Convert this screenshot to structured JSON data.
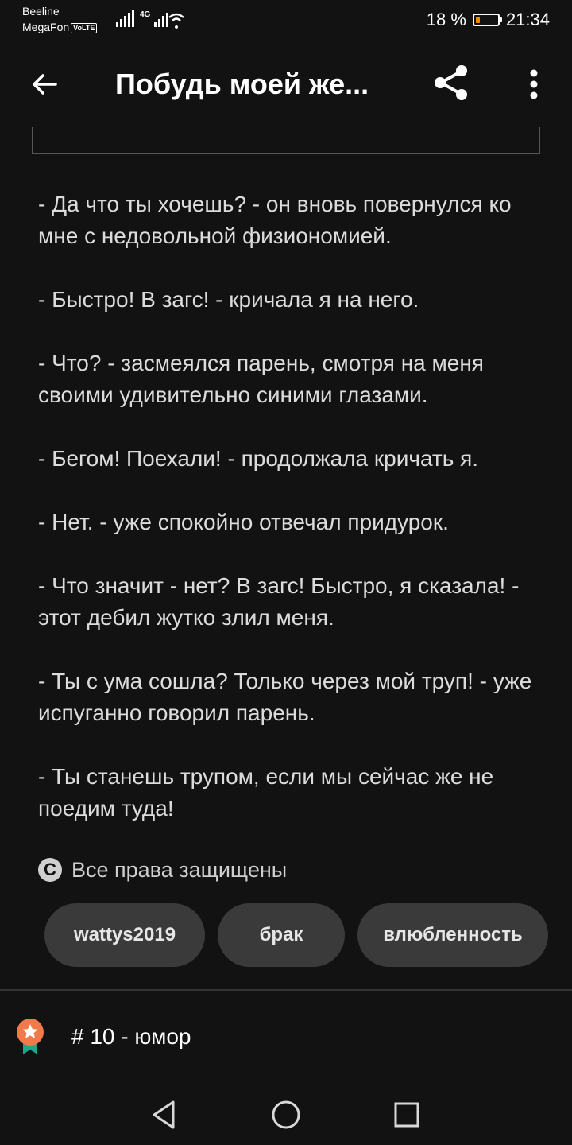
{
  "status_bar": {
    "carrier_1": "Beeline",
    "carrier_2": "MegaFon",
    "volte_badge": "VoLTE",
    "network_type": "4G",
    "battery_percent": "18 %",
    "battery_level": 0.18,
    "battery_color": "#f08a00",
    "time": "21:34"
  },
  "app_bar": {
    "back_icon": "arrow-left-icon",
    "title": "Побудь моей же...",
    "share_icon": "share-icon",
    "more_icon": "more-vertical-icon"
  },
  "story": {
    "paragraphs": [
      "- Да что ты хочешь? - он вновь повернулся ко мне с недовольной физиономией.",
      "- Быстро! В загс! - кричала я на него.",
      "- Что? - засмеялся парень, смотря на меня своими удивительно синими глазами.",
      "- Бегом! Поехали! - продолжала кричать я.",
      "- Нет. - уже спокойно отвечал придурок.",
      "- Что значит - нет? В загс! Быстро, я сказала! - этот дебил жутко злил меня.",
      "- Ты с ума сошла? Только через мой труп! - уже испуганно говорил парень.",
      "- Ты станешь трупом, если мы сейчас же не поедим туда!"
    ]
  },
  "copyright": {
    "icon": "copyright-icon",
    "text": "Все права защищены"
  },
  "tags": [
    {
      "label": "wattys2019"
    },
    {
      "label": "брак"
    },
    {
      "label": "влюбленность"
    }
  ],
  "ranking": {
    "icon": "ranking-badge-icon",
    "badge_color": "#f07a4a",
    "ribbon_color": "#1fa58a",
    "text": "# 10 - юмор"
  },
  "nav_bar": {
    "back_icon": "nav-back-triangle-icon",
    "home_icon": "nav-home-circle-icon",
    "recents_icon": "nav-recents-square-icon"
  }
}
